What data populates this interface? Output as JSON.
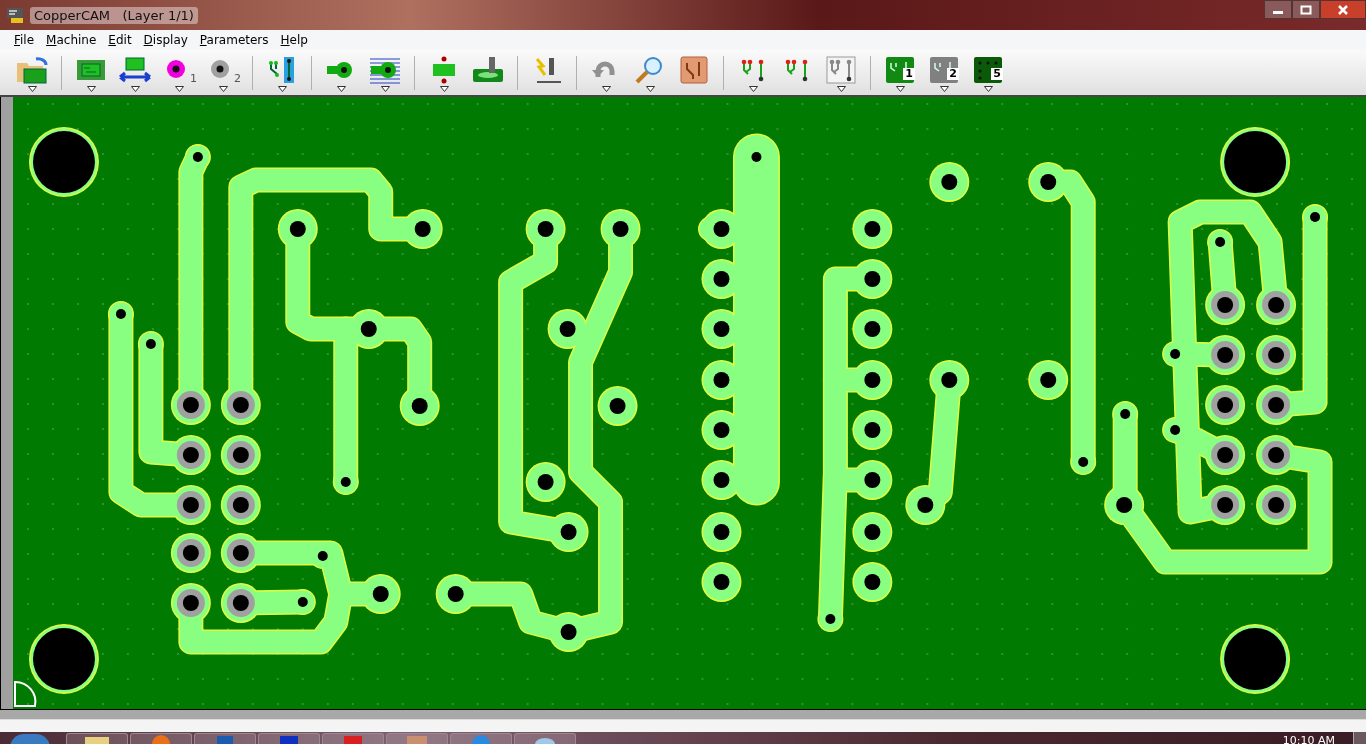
{
  "window": {
    "title": "CopperCAM   (Layer 1/1)"
  },
  "menu": [
    {
      "label": "File"
    },
    {
      "label": "Machine"
    },
    {
      "label": "Edit"
    },
    {
      "label": "Display"
    },
    {
      "label": "Parameters"
    },
    {
      "label": "Help"
    }
  ],
  "toolbar": [
    [
      {
        "kind": "open",
        "menu": true
      }
    ],
    [
      {
        "kind": "board",
        "menu": true
      },
      {
        "kind": "board-arrows",
        "menu": true
      },
      {
        "kind": "pad-magenta",
        "label": "1",
        "menu": true
      },
      {
        "kind": "pad-grey",
        "label": "2",
        "menu": true
      }
    ],
    [
      {
        "kind": "tracks-blue",
        "menu": true
      }
    ],
    [
      {
        "kind": "pad-shape",
        "menu": true
      },
      {
        "kind": "pad-hatch",
        "menu": true
      }
    ],
    [
      {
        "kind": "board-drill",
        "menu": true
      },
      {
        "kind": "mill",
        "menu": false
      }
    ],
    [
      {
        "kind": "lightning",
        "menu": false
      }
    ],
    [
      {
        "kind": "undo",
        "menu": true
      },
      {
        "kind": "magnifier",
        "menu": true
      },
      {
        "kind": "copper",
        "menu": false
      }
    ],
    [
      {
        "kind": "tracks-red",
        "menu": true
      },
      {
        "kind": "tracks-red2",
        "menu": false
      },
      {
        "kind": "tracks-grey",
        "menu": true
      }
    ],
    [
      {
        "kind": "layer-green",
        "label": "1",
        "menu": true
      },
      {
        "kind": "layer-grey",
        "label": "2",
        "menu": true
      },
      {
        "kind": "layer-dots",
        "label": "5",
        "menu": true
      }
    ]
  ],
  "taskbar": {
    "apps": [
      {
        "kind": "folder"
      },
      {
        "kind": "browser"
      },
      {
        "kind": "photo"
      },
      {
        "kind": "floppy"
      },
      {
        "kind": "red"
      },
      {
        "kind": "copper"
      },
      {
        "kind": "globe"
      },
      {
        "kind": "paint"
      }
    ],
    "clock": "10:10 AM"
  }
}
